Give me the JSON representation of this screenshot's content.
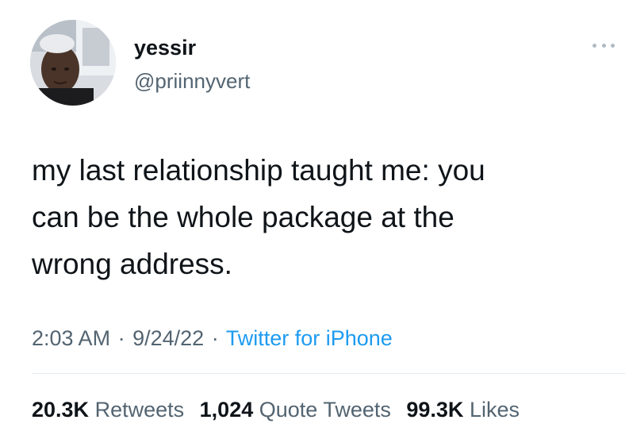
{
  "user": {
    "display_name": "yessir",
    "handle": "@priinnyvert"
  },
  "tweet": {
    "text": "my last relationship taught me: you\ncan be the whole package at the\nwrong address.",
    "time": "2:03 AM",
    "date": "9/24/22",
    "source": "Twitter for iPhone",
    "separator": "·"
  },
  "stats": {
    "retweets_count": "20.3K",
    "retweets_label": "Retweets",
    "quotes_count": "1,024",
    "quotes_label": "Quote Tweets",
    "likes_count": "99.3K",
    "likes_label": "Likes"
  },
  "icons": {
    "more": "more-options-icon"
  },
  "colors": {
    "text": "#0f1419",
    "secondary": "#536471",
    "link": "#1d9bf0",
    "divider": "#e1e8ed"
  }
}
